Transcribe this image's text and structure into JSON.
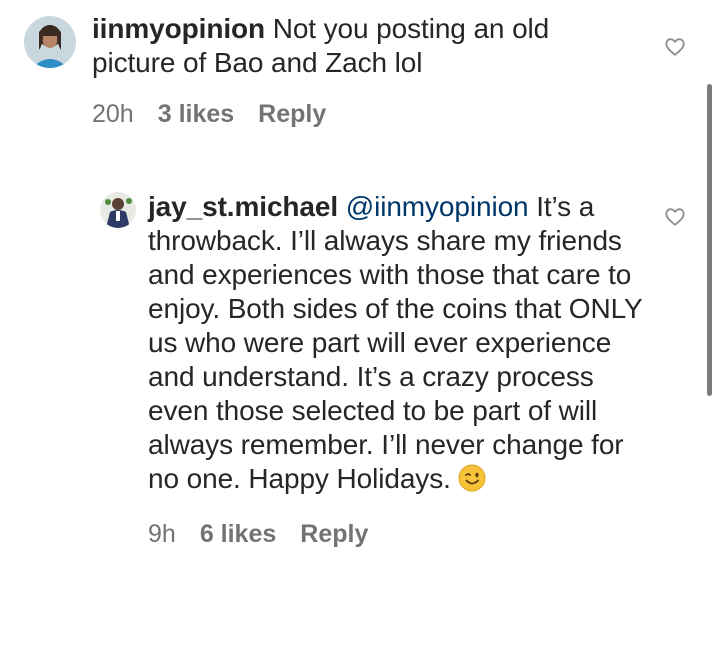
{
  "comments": [
    {
      "username": "iinmyopinion",
      "text": " Not you posting an old picture of Bao and Zach lol",
      "time": "20h",
      "likes": "3 likes",
      "reply": "Reply"
    },
    {
      "username": "jay_st.michael",
      "mention": "@iinmyopinion",
      "text": " It’s a throwback. I’ll always share my friends and experiences with those that care to enjoy. Both sides of the coins that ONLY us who were part will ever experience and understand. It’s a crazy process even those selected to be part of will always remember. I’ll never change for no one. Happy Holidays. ",
      "emoji": "winking-face",
      "time": "9h",
      "likes": "6 likes",
      "reply": "Reply"
    }
  ],
  "icons": {
    "heart": "heart-outline-icon",
    "accent_mention": "#00376b",
    "meta_gray": "#737373"
  }
}
